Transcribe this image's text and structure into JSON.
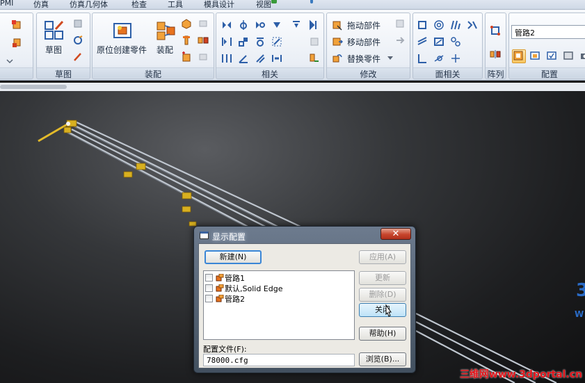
{
  "menu": {
    "tabs": [
      "PMI",
      "仿真",
      "仿真几何体",
      "检查",
      "工具",
      "模具设计",
      "视图"
    ]
  },
  "ribbon": {
    "groups": {
      "sketch": {
        "label": "草图",
        "sketch_button": "草图"
      },
      "assembly": {
        "label": "装配",
        "create_in_place": "原位创建零件",
        "assemble": "装配"
      },
      "relations": {
        "label": "相关"
      },
      "modify": {
        "label": "修改",
        "drag_component": "拖动部件",
        "move_component": "移动部件",
        "replace_part": "替换零件"
      },
      "face_relations": {
        "label": "面相关"
      },
      "pattern": {
        "label": "阵列"
      },
      "configuration": {
        "label": "配置",
        "config_combo_value": "管路2"
      }
    }
  },
  "dialog": {
    "title": "显示配置",
    "close_glyph": "✕",
    "new_button": "新建(N)",
    "apply_button": "应用(A)",
    "update_button": "更新",
    "delete_button": "删除(D)",
    "close_button": "关闭",
    "help_button": "帮助(H)",
    "browse_button": "浏览(B)...",
    "config_items": [
      {
        "label": "管路1",
        "checked": false
      },
      {
        "label": "默认,Solid Edge",
        "checked": false
      },
      {
        "label": "管路2",
        "checked": false
      }
    ],
    "file_label": "配置文件(F):",
    "file_value": "78000.cfg"
  },
  "watermark": "三维网www.3dportal.cn",
  "colors": {
    "accent_orange": "#f0a030",
    "part_yellow": "#d8b020",
    "dialog_close_red": "#c7452c"
  }
}
